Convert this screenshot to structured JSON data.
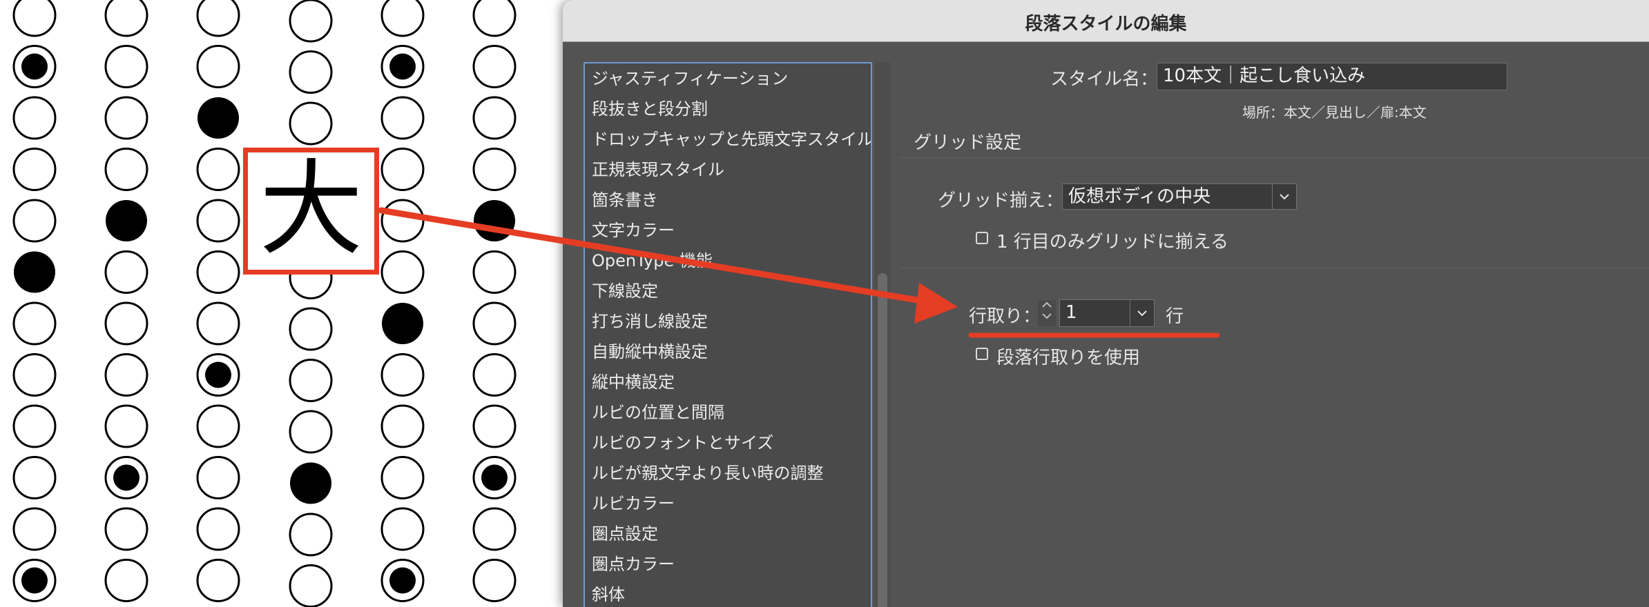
{
  "dialog": {
    "title": "段落スタイルの編集"
  },
  "sidebar": {
    "items": [
      "ジャスティフィケーション",
      "段抜きと段分割",
      "ドロップキャップと先頭文字スタイル",
      "正規表現スタイル",
      "箇条書き",
      "文字カラー",
      "OpenType 機能",
      "下線設定",
      "打ち消し線設定",
      "自動縦中横設定",
      "縦中横設定",
      "ルビの位置と間隔",
      "ルビのフォントとサイズ",
      "ルビが親文字より長い時の調整",
      "ルビカラー",
      "圏点設定",
      "圏点カラー",
      "斜体"
    ]
  },
  "style": {
    "name_label": "スタイル名：",
    "name_value": "10本文｜起こし食い込み",
    "location_label": "場所：",
    "location_value": "本文／見出し／扉:本文"
  },
  "grid": {
    "section_title": "グリッド設定",
    "align_label": "グリッド揃え：",
    "align_value": "仮想ボディの中央",
    "first_line_only_label": "1 行目のみグリッドに揃える",
    "line_span_label": "行取り：",
    "line_span_value": "1",
    "line_span_unit": "行",
    "use_paragraph_span_label": "段落行取りを使用"
  },
  "annotation": {
    "glyph": "大",
    "accent_color": "#e53d24"
  },
  "colors": {
    "dialog_bg": "#535353",
    "titlebar_bg": "#e2e2e2",
    "list_border": "#6f9ad6"
  }
}
